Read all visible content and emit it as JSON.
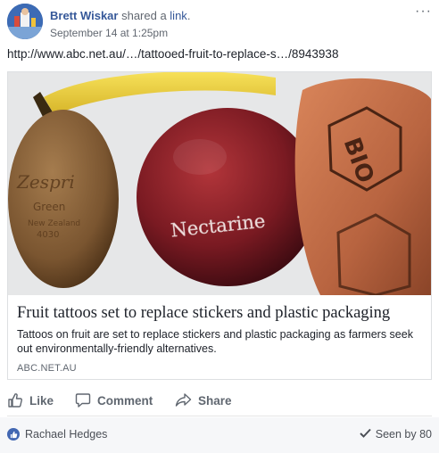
{
  "post": {
    "author": "Brett Wiskar",
    "action_prefix": "shared a ",
    "action_link": "link",
    "action_suffix": ".",
    "timestamp": "September 14 at 1:25pm",
    "more_menu": "···",
    "shared_url": "http://www.abc.net.au/…/tattooed-fruit-to-replace-s…/8943938"
  },
  "card": {
    "image_text": [
      "Zespri",
      "Green",
      "New Zealand",
      "4030",
      "Nectarine",
      "BIO"
    ],
    "title": "Fruit tattoos set to replace stickers and plastic packaging",
    "description": "Tattoos on fruit are set to replace stickers and plastic packaging as farmers seek out environmentally-friendly alternatives.",
    "domain": "ABC.NET.AU"
  },
  "actions": [
    {
      "label": "Like",
      "icon": "thumbs-up-icon"
    },
    {
      "label": "Comment",
      "icon": "speech-bubble-icon"
    },
    {
      "label": "Share",
      "icon": "share-arrow-icon"
    }
  ],
  "footer": {
    "reactor_name": "Rachael Hedges",
    "seen_by": "Seen by 80"
  },
  "colors": {
    "link_blue": "#365899",
    "like_blue": "#4267b2",
    "meta_gray": "#616770",
    "footer_bg": "#f6f7f9"
  }
}
